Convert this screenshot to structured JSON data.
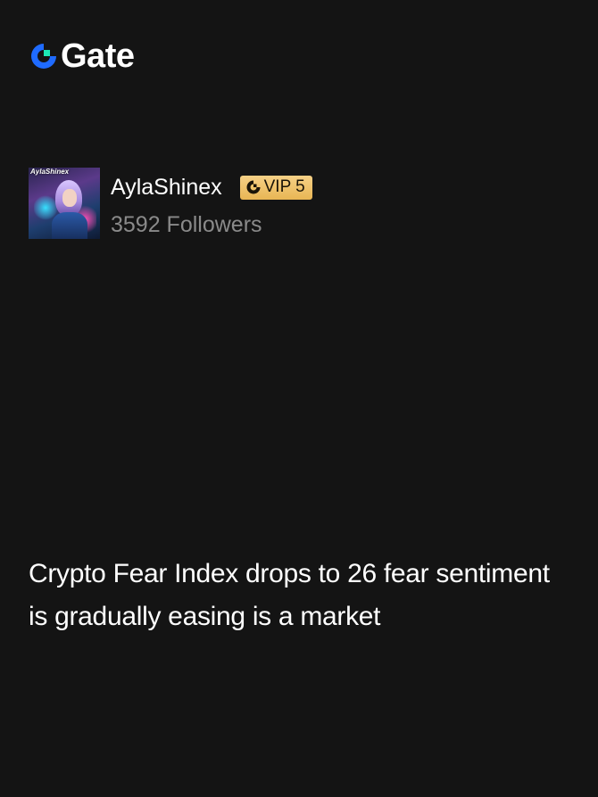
{
  "brand": {
    "logo_text": "Gate",
    "logo_icon": "gate-logo-icon",
    "colors": {
      "logo_blue": "#1f6bff",
      "logo_green": "#1de9b6"
    }
  },
  "author": {
    "avatar_label": "AylaShinex",
    "name": "AylaShinex",
    "vip_label": "VIP 5",
    "vip_icon": "gate-vip-icon",
    "followers": "3592 Followers"
  },
  "post": {
    "text": "Crypto Fear Index drops to 26 fear sentiment is gradually easing is a market"
  },
  "colors": {
    "background": "#141414",
    "text_primary": "#ffffff",
    "text_secondary": "#8a8a8a",
    "vip_badge": "#f0c56a"
  }
}
